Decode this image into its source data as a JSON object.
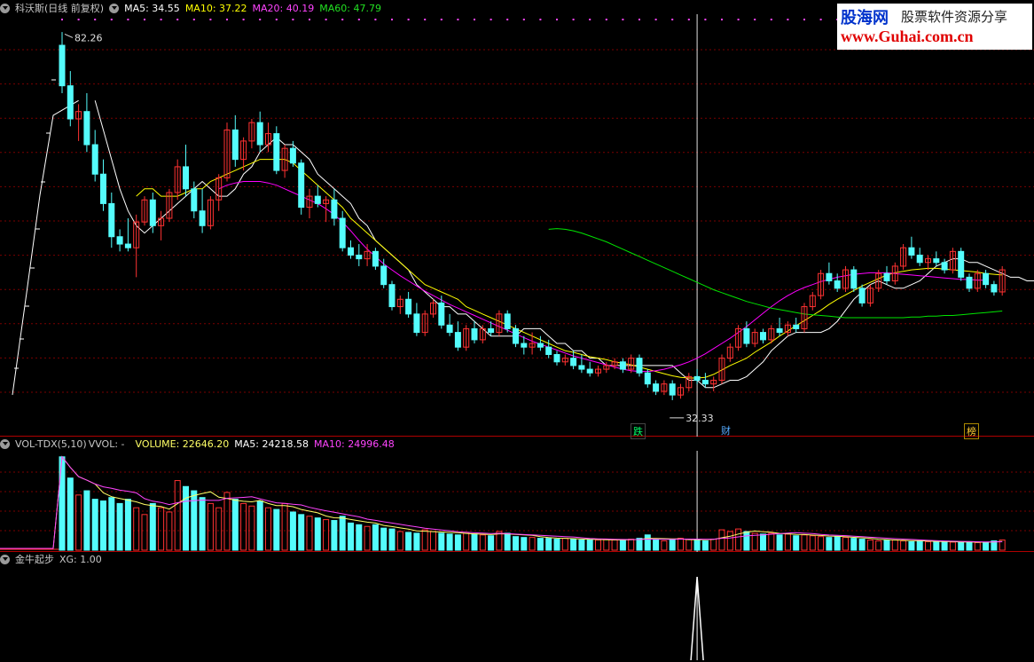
{
  "main": {
    "stock_title": "科沃斯(日线 前复权)",
    "ma5": "MA5: 34.55",
    "ma10": "MA10: 37.22",
    "ma20": "MA20: 40.19",
    "ma60": "MA60: 47.79",
    "high_label": "82.26",
    "low_label": "32.33",
    "markers": [
      "跌",
      "财",
      "榜"
    ]
  },
  "vol": {
    "title": "VOL-TDX(5,10)",
    "vvol": "VVOL: -",
    "volume": "VOLUME: 22646.20",
    "ma5": "MA5: 24218.58",
    "ma10": "MA10: 24996.48"
  },
  "ind": {
    "title": "金牛起步",
    "xg": "XG: 1.00"
  },
  "watermark": {
    "site": "股海网",
    "tagline": "股票软件资源分享",
    "url": "www.Guhai.com.cn"
  },
  "colors": {
    "up": "#ff3232",
    "down": "#54fcfc",
    "ma5": "#ffffff",
    "ma10": "#ffff00",
    "ma20": "#ff00ff",
    "ma60": "#00e600",
    "grid": "#7a0000"
  },
  "chart_data": [
    {
      "type": "candlestick",
      "title": "科沃斯(日线 前复权)",
      "ylim": [
        30,
        84
      ],
      "annotations": [
        {
          "label": "82.26",
          "type": "high"
        },
        {
          "label": "32.33",
          "type": "low"
        }
      ],
      "candles": [
        [
          80.5,
          82.3,
          74.0,
          75.0
        ],
        [
          75.0,
          77.0,
          69.5,
          70.5
        ],
        [
          70.5,
          72.5,
          67.5,
          71.5
        ],
        [
          71.5,
          74.0,
          66.0,
          67.0
        ],
        [
          67.0,
          69.0,
          62.0,
          63.0
        ],
        [
          63.0,
          65.0,
          58.0,
          59.0
        ],
        [
          59.0,
          60.5,
          53.0,
          54.5
        ],
        [
          54.5,
          55.5,
          52.5,
          53.5
        ],
        [
          53.5,
          57.0,
          52.5,
          53.0
        ],
        [
          53.0,
          57.5,
          49.0,
          56.5
        ],
        [
          56.5,
          60.0,
          56.0,
          59.5
        ],
        [
          59.5,
          60.5,
          55.0,
          56.0
        ],
        [
          56.0,
          58.0,
          54.0,
          57.0
        ],
        [
          57.0,
          61.0,
          56.5,
          60.5
        ],
        [
          60.5,
          65.0,
          59.5,
          64.0
        ],
        [
          64.0,
          67.0,
          60.0,
          61.0
        ],
        [
          61.0,
          62.0,
          57.0,
          58.0
        ],
        [
          58.0,
          61.0,
          55.0,
          56.0
        ],
        [
          56.0,
          60.0,
          55.5,
          59.5
        ],
        [
          59.5,
          63.0,
          58.0,
          62.5
        ],
        [
          62.5,
          70.0,
          62.0,
          69.0
        ],
        [
          69.0,
          71.0,
          64.0,
          65.0
        ],
        [
          65.0,
          68.0,
          63.5,
          67.5
        ],
        [
          67.5,
          70.5,
          66.5,
          70.0
        ],
        [
          70.0,
          71.5,
          66.0,
          67.0
        ],
        [
          67.0,
          70.0,
          66.0,
          68.5
        ],
        [
          68.5,
          69.5,
          63.0,
          63.5
        ],
        [
          63.5,
          67.0,
          62.5,
          66.5
        ],
        [
          66.5,
          67.5,
          64.0,
          64.5
        ],
        [
          64.5,
          65.0,
          57.5,
          58.5
        ],
        [
          58.5,
          61.0,
          57.0,
          60.0
        ],
        [
          60.0,
          61.5,
          58.5,
          59.0
        ],
        [
          59.0,
          60.0,
          56.5,
          59.5
        ],
        [
          59.5,
          61.0,
          56.0,
          57.0
        ],
        [
          57.0,
          58.0,
          52.5,
          53.0
        ],
        [
          53.0,
          54.0,
          51.5,
          52.0
        ],
        [
          52.0,
          53.5,
          50.5,
          51.5
        ],
        [
          51.5,
          53.5,
          50.5,
          52.5
        ],
        [
          52.5,
          53.0,
          50.0,
          50.5
        ],
        [
          50.5,
          51.5,
          47.5,
          48.0
        ],
        [
          48.0,
          48.5,
          44.5,
          45.0
        ],
        [
          45.0,
          46.5,
          44.0,
          46.0
        ],
        [
          46.0,
          47.0,
          43.5,
          44.0
        ],
        [
          44.0,
          45.5,
          41.0,
          41.5
        ],
        [
          41.5,
          44.5,
          41.0,
          44.0
        ],
        [
          44.0,
          46.0,
          43.5,
          45.5
        ],
        [
          45.5,
          46.5,
          42.0,
          42.5
        ],
        [
          42.5,
          44.0,
          41.0,
          41.5
        ],
        [
          41.5,
          43.0,
          39.0,
          39.5
        ],
        [
          39.5,
          42.5,
          39.0,
          42.0
        ],
        [
          42.0,
          43.0,
          40.0,
          40.5
        ],
        [
          40.5,
          42.5,
          40.0,
          42.0
        ],
        [
          42.0,
          43.0,
          41.0,
          41.5
        ],
        [
          41.5,
          44.5,
          41.0,
          44.0
        ],
        [
          44.0,
          44.5,
          41.5,
          42.0
        ],
        [
          42.0,
          42.5,
          39.5,
          40.0
        ],
        [
          40.0,
          41.0,
          38.5,
          39.5
        ],
        [
          39.5,
          41.5,
          38.5,
          40.0
        ],
        [
          40.0,
          41.0,
          39.0,
          39.5
        ],
        [
          39.5,
          40.5,
          38.0,
          38.5
        ],
        [
          38.5,
          39.0,
          37.0,
          37.5
        ],
        [
          37.5,
          38.5,
          37.0,
          38.0
        ],
        [
          38.0,
          39.0,
          36.5,
          37.0
        ],
        [
          37.0,
          38.5,
          36.0,
          36.5
        ],
        [
          36.5,
          37.5,
          35.5,
          36.0
        ],
        [
          36.0,
          37.0,
          35.5,
          36.5
        ],
        [
          36.5,
          37.5,
          36.0,
          37.0
        ],
        [
          37.0,
          38.0,
          36.5,
          37.5
        ],
        [
          37.5,
          38.0,
          36.0,
          36.5
        ],
        [
          36.5,
          38.5,
          36.0,
          38.0
        ],
        [
          38.0,
          38.5,
          35.5,
          36.0
        ],
        [
          36.0,
          36.5,
          34.0,
          34.5
        ],
        [
          34.5,
          35.0,
          33.0,
          33.5
        ],
        [
          33.5,
          35.0,
          33.0,
          34.5
        ],
        [
          34.5,
          35.0,
          32.3,
          33.0
        ],
        [
          33.0,
          34.5,
          32.5,
          34.0
        ],
        [
          34.0,
          36.0,
          33.5,
          35.5
        ],
        [
          35.5,
          36.5,
          34.5,
          35.0
        ],
        [
          35.0,
          36.0,
          34.0,
          34.5
        ],
        [
          34.5,
          35.5,
          33.5,
          35.0
        ],
        [
          35.0,
          38.5,
          34.5,
          38.0
        ],
        [
          38.0,
          40.0,
          37.5,
          39.5
        ],
        [
          39.5,
          42.5,
          39.0,
          42.0
        ],
        [
          42.0,
          43.0,
          39.5,
          40.0
        ],
        [
          40.0,
          42.0,
          39.5,
          41.5
        ],
        [
          41.5,
          42.0,
          40.0,
          40.5
        ],
        [
          40.5,
          42.5,
          40.0,
          42.0
        ],
        [
          42.0,
          43.5,
          41.0,
          41.5
        ],
        [
          41.5,
          43.0,
          41.0,
          42.5
        ],
        [
          42.5,
          43.5,
          41.5,
          42.0
        ],
        [
          42.0,
          45.5,
          41.5,
          45.0
        ],
        [
          45.0,
          47.0,
          44.5,
          46.5
        ],
        [
          46.5,
          50.0,
          46.0,
          49.5
        ],
        [
          49.5,
          51.0,
          48.0,
          48.5
        ],
        [
          48.5,
          49.5,
          47.0,
          47.5
        ],
        [
          47.5,
          50.5,
          47.0,
          50.0
        ],
        [
          50.0,
          50.5,
          47.0,
          47.5
        ],
        [
          47.5,
          48.0,
          45.0,
          45.5
        ],
        [
          45.5,
          48.0,
          45.0,
          47.5
        ],
        [
          47.5,
          50.0,
          47.0,
          49.5
        ],
        [
          49.5,
          50.5,
          48.0,
          48.5
        ],
        [
          48.5,
          51.0,
          48.0,
          50.5
        ],
        [
          50.5,
          53.5,
          50.0,
          53.0
        ],
        [
          53.0,
          54.5,
          51.5,
          52.0
        ],
        [
          52.0,
          53.0,
          50.5,
          51.0
        ],
        [
          51.0,
          52.0,
          50.0,
          51.5
        ],
        [
          51.5,
          52.5,
          50.5,
          51.0
        ],
        [
          51.0,
          51.5,
          49.5,
          50.0
        ],
        [
          50.0,
          53.0,
          49.5,
          52.5
        ],
        [
          52.5,
          53.0,
          48.5,
          49.0
        ],
        [
          49.0,
          49.5,
          47.0,
          47.5
        ],
        [
          47.5,
          50.0,
          47.0,
          49.5
        ],
        [
          49.5,
          50.0,
          47.5,
          48.0
        ],
        [
          48.0,
          48.5,
          46.5,
          47.0
        ],
        [
          47.0,
          50.5,
          46.5,
          50.0
        ]
      ],
      "ma_lines": [
        {
          "name": "MA5",
          "start": 4,
          "values": [
            73,
            69,
            65,
            61,
            58,
            56,
            55,
            56,
            57,
            58,
            59,
            60,
            61,
            62,
            61,
            60,
            60,
            61,
            63,
            64,
            66,
            67,
            68,
            67,
            67,
            66,
            65,
            63,
            62,
            61,
            60,
            59,
            57,
            56,
            54,
            53,
            52,
            51,
            50,
            48,
            47,
            46,
            45,
            45,
            44,
            44,
            43,
            42,
            41,
            41,
            41,
            41,
            42,
            42,
            42,
            41,
            40,
            40,
            39,
            39,
            38,
            38,
            37,
            37,
            37,
            37,
            37,
            37,
            37,
            37,
            37,
            36,
            35,
            35,
            34,
            34,
            34.5,
            35,
            35,
            35.5,
            36.5,
            37.5,
            39,
            40,
            41,
            41.5,
            41.5,
            41.5,
            41.5,
            42,
            43,
            44.5,
            46,
            47,
            48,
            48.5,
            48,
            47.5,
            47.5,
            48,
            48.5,
            49.5,
            50.5,
            51,
            51.5,
            51.5,
            51,
            51,
            50.5,
            50,
            49.5,
            49,
            49,
            48.5,
            48.5
          ]
        },
        {
          "name": "MA10",
          "start": 9,
          "values": [
            60,
            61,
            61,
            60,
            60,
            60,
            60.5,
            61,
            61,
            62,
            62.5,
            63,
            63.5,
            64,
            64.5,
            65,
            65,
            65,
            65,
            64.5,
            63.5,
            62.5,
            61.5,
            60.5,
            59.5,
            58.5,
            57,
            56,
            55,
            54,
            53,
            52,
            51,
            50,
            49,
            48,
            47.5,
            47,
            46.5,
            46,
            45,
            44.5,
            44,
            43.5,
            43,
            42.5,
            42,
            41.5,
            41,
            40.5,
            40,
            39.5,
            39,
            38.8,
            38.5,
            38.2,
            38,
            37.8,
            37.5,
            37.3,
            37.1,
            36.8,
            36.5,
            36.2,
            35.9,
            35.6,
            35.4,
            35.3,
            35.3,
            35.4,
            35.8,
            36.4,
            37,
            37.5,
            38,
            38.8,
            39.5,
            40.2,
            41,
            41.7,
            42.4,
            43.1,
            43.8,
            44.5,
            45.3,
            46,
            46.6,
            47.2,
            47.8,
            48.3,
            48.8,
            49.3,
            49.6,
            49.8,
            50,
            50.1,
            50.2,
            50.2,
            50.1,
            50,
            49.9,
            49.8,
            49.7,
            49.5,
            49.4,
            49.3
          ]
        },
        {
          "name": "MA20",
          "start": 19,
          "values": [
            61,
            61.5,
            61.8,
            62,
            62,
            62,
            61.8,
            61.5,
            61,
            60.5,
            60,
            59.5,
            59,
            58.3,
            57.5,
            56.5,
            55.3,
            54,
            52.8,
            51.8,
            50.8,
            50,
            49.2,
            48.5,
            47.8,
            47.1,
            46.5,
            45.9,
            45.3,
            44.8,
            44.3,
            43.8,
            43.3,
            42.8,
            42.3,
            41.8,
            41.3,
            40.8,
            40.3,
            39.9,
            39.5,
            39.1,
            38.7,
            38.3,
            38,
            37.7,
            37.4,
            37.1,
            36.8,
            36.5,
            36.3,
            36.2,
            36.2,
            36.3,
            36.5,
            36.8,
            37.1,
            37.5,
            38,
            38.6,
            39.3,
            40,
            40.7,
            41.5,
            42.3,
            43.2,
            44.1,
            45,
            45.8,
            46.5,
            47.1,
            47.6,
            48,
            48.4,
            48.7,
            49,
            49.2,
            49.4,
            49.5,
            49.6,
            49.6,
            49.6,
            49.5,
            49.4,
            49.3,
            49.2,
            49.1,
            49.0,
            48.9,
            48.8,
            48.7,
            48.7,
            48.6,
            48.6
          ]
        },
        {
          "name": "MA60",
          "start": 59,
          "values": [
            55.5,
            55.6,
            55.5,
            55.3,
            55,
            54.6,
            54.2,
            53.8,
            53.3,
            52.8,
            52.3,
            51.8,
            51.3,
            50.8,
            50.3,
            49.8,
            49.3,
            48.8,
            48.3,
            47.8,
            47.3,
            46.9,
            46.5,
            46.1,
            45.7,
            45.4,
            45.1,
            44.8,
            44.6,
            44.4,
            44.2,
            44,
            43.9,
            43.8,
            43.7,
            43.6,
            43.5,
            43.5,
            43.5,
            43.5,
            43.5,
            43.5,
            43.5,
            43.5,
            43.6,
            43.6,
            43.7,
            43.7,
            43.8,
            43.8,
            43.9,
            44,
            44.1,
            44.2,
            44.3,
            44.4
          ]
        }
      ]
    },
    {
      "type": "bar",
      "title": "VOL-TDX(5,10)",
      "ylim": [
        0,
        115000
      ],
      "values": [
        110000,
        85000,
        65000,
        70000,
        60000,
        58000,
        62000,
        55000,
        60000,
        50000,
        42000,
        55000,
        50000,
        45000,
        82000,
        75000,
        70000,
        62000,
        55000,
        50000,
        68000,
        60000,
        55000,
        52000,
        58000,
        50000,
        48000,
        55000,
        45000,
        42000,
        40000,
        38000,
        36000,
        35000,
        40000,
        32000,
        30000,
        28000,
        30000,
        26000,
        25000,
        22000,
        21000,
        20000,
        24000,
        22000,
        20000,
        19000,
        18000,
        20000,
        19000,
        18000,
        17000,
        22000,
        20000,
        16000,
        15000,
        15000,
        14000,
        14000,
        13000,
        14000,
        13000,
        12000,
        12000,
        12000,
        12500,
        12000,
        12000,
        13000,
        14000,
        18000,
        12000,
        11000,
        12000,
        14000,
        13000,
        12000,
        11000,
        13000,
        24000,
        22000,
        25000,
        22000,
        20000,
        19000,
        20000,
        18000,
        19000,
        17000,
        18000,
        17000,
        16000,
        15000,
        16000,
        15000,
        14000,
        13000,
        12000,
        11000,
        12000,
        12000,
        11000,
        10000,
        11000,
        10000,
        10000,
        9500,
        9500,
        9000,
        10000,
        9000,
        9500,
        11000,
        12000
      ],
      "ma_lines": [
        {
          "name": "MA5",
          "color": "#ffffff"
        },
        {
          "name": "MA10",
          "color": "#ff00ff"
        }
      ]
    },
    {
      "type": "line",
      "title": "金牛起步",
      "signal_index": 77,
      "values_desc": "XG signal 0 except 1 at candle 77"
    }
  ]
}
